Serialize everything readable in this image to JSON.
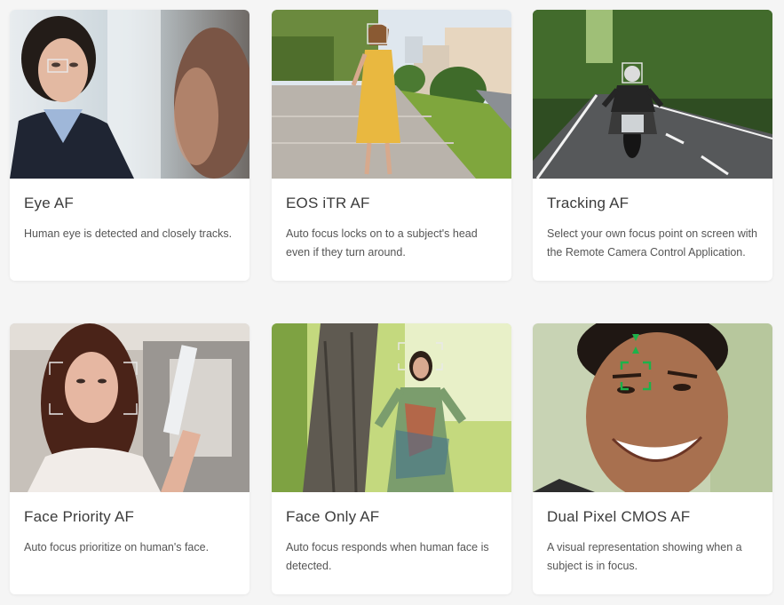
{
  "cards": [
    {
      "title": "Eye AF",
      "desc": "Human eye is detected and closely tracks.",
      "image": "eye-af-photo"
    },
    {
      "title": "EOS iTR AF",
      "desc": "Auto focus locks on to a subject's head even if they turn around.",
      "image": "eos-itr-af-photo"
    },
    {
      "title": "Tracking AF",
      "desc": "Select your own focus point on screen with the Remote Camera Control Application.",
      "image": "tracking-af-photo"
    },
    {
      "title": "Face Priority AF",
      "desc": "Auto focus prioritize on human's face.",
      "image": "face-priority-af-photo"
    },
    {
      "title": "Face Only AF",
      "desc": "Auto focus responds when human face is detected.",
      "image": "face-only-af-photo"
    },
    {
      "title": "Dual Pixel CMOS AF",
      "desc": "A visual representation showing when a subject is in focus.",
      "image": "dual-pixel-cmos-af-photo"
    }
  ],
  "colors": {
    "page_bg": "#f5f5f5",
    "card_bg": "#ffffff",
    "title": "#3b3b3b",
    "text": "#555555",
    "focus_green": "#1db24a"
  }
}
